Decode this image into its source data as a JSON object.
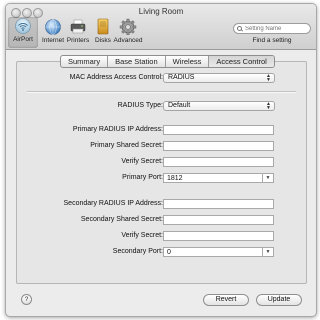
{
  "window": {
    "title": "Living Room"
  },
  "toolbar": {
    "items": [
      {
        "label": "AirPort",
        "icon": "airport-wifi-icon",
        "selected": true
      },
      {
        "label": "Internet",
        "icon": "globe-icon"
      },
      {
        "label": "Printers",
        "icon": "printer-icon"
      },
      {
        "label": "Disks",
        "icon": "disk-icon"
      },
      {
        "label": "Advanced",
        "icon": "gear-icon"
      }
    ],
    "search": {
      "placeholder": "Setting Name",
      "label": "Find a setting"
    }
  },
  "tabs": [
    {
      "label": "Summary"
    },
    {
      "label": "Base Station"
    },
    {
      "label": "Wireless"
    },
    {
      "label": "Access Control",
      "active": true
    }
  ],
  "form": {
    "mac_access_control": {
      "label": "MAC Address Access Control:",
      "value": "RADIUS"
    },
    "radius_type": {
      "label": "RADIUS Type:",
      "value": "Default"
    },
    "primary_ip": {
      "label": "Primary RADIUS IP Address:",
      "value": ""
    },
    "primary_secret": {
      "label": "Primary Shared Secret:",
      "value": ""
    },
    "primary_verify": {
      "label": "Verify Secret:",
      "value": ""
    },
    "primary_port": {
      "label": "Primary Port:",
      "value": "1812"
    },
    "secondary_ip": {
      "label": "Secondary RADIUS IP Address:",
      "value": ""
    },
    "secondary_secret": {
      "label": "Secondary Shared Secret:",
      "value": ""
    },
    "secondary_verify": {
      "label": "Verify Secret:",
      "value": ""
    },
    "secondary_port": {
      "label": "Secondary Port:",
      "value": "0"
    }
  },
  "footer": {
    "help": "?",
    "revert": "Revert",
    "update": "Update"
  }
}
